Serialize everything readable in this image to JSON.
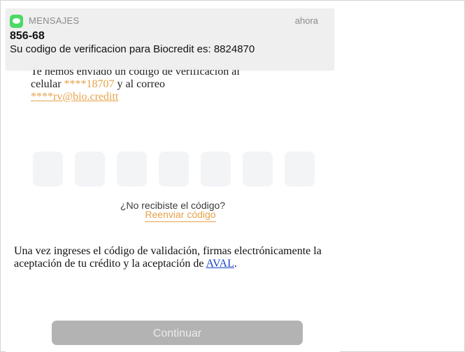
{
  "notification": {
    "app_name": "MENSAJES",
    "time": "ahora",
    "sender": "856-68",
    "body": "Su codigo de verificacion para Biocredit es: 8824870",
    "icon": "messages-icon"
  },
  "intro": {
    "line1": "Te hemos enviado un código de verificación al",
    "celular_label": "celular ",
    "phone_masked": "****18707",
    "and_email": " y al correo",
    "email_masked": "****rv@bio.creditt"
  },
  "code": {
    "digit_count": 7
  },
  "resend": {
    "question": "¿No recibiste el código?",
    "link": "Reenviar código"
  },
  "legal": {
    "text": "Una vez ingreses el código de validación, firmas electrónicamente la aceptación de tu crédito y la aceptación de ",
    "link": "AVAL",
    "end": "."
  },
  "continue_button": {
    "label": "Continuar"
  },
  "colors": {
    "accent": "#e6a24a",
    "link_blue": "#1a45c8",
    "button_disabled": "#b3b3b3",
    "messages_green": "#4cd964"
  }
}
